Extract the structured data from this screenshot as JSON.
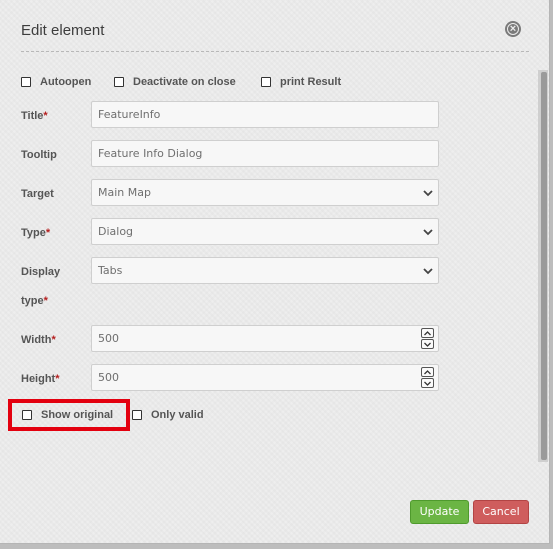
{
  "dialog": {
    "title": "Edit element"
  },
  "options": {
    "autoopen": "Autoopen",
    "deactivate_on_close": "Deactivate on close",
    "print_result": "print Result",
    "show_original": "Show original",
    "only_valid": "Only valid"
  },
  "fields": {
    "title": {
      "label": "Title",
      "value": "FeatureInfo"
    },
    "tooltip": {
      "label": "Tooltip",
      "value": "Feature Info Dialog"
    },
    "target": {
      "label": "Target",
      "value": "Main Map"
    },
    "type": {
      "label": "Type",
      "value": "Dialog"
    },
    "display_type": {
      "label_line1": "Display",
      "label_line2": "type",
      "value": "Tabs"
    },
    "width": {
      "label": "Width",
      "value": "500"
    },
    "height": {
      "label": "Height",
      "value": "500"
    }
  },
  "required_marker": "*",
  "buttons": {
    "update": "Update",
    "cancel": "Cancel"
  },
  "colors": {
    "required": "#b41f1f",
    "update": "#6bb544",
    "cancel": "#cf5d5d",
    "highlight": "#e3000f"
  }
}
